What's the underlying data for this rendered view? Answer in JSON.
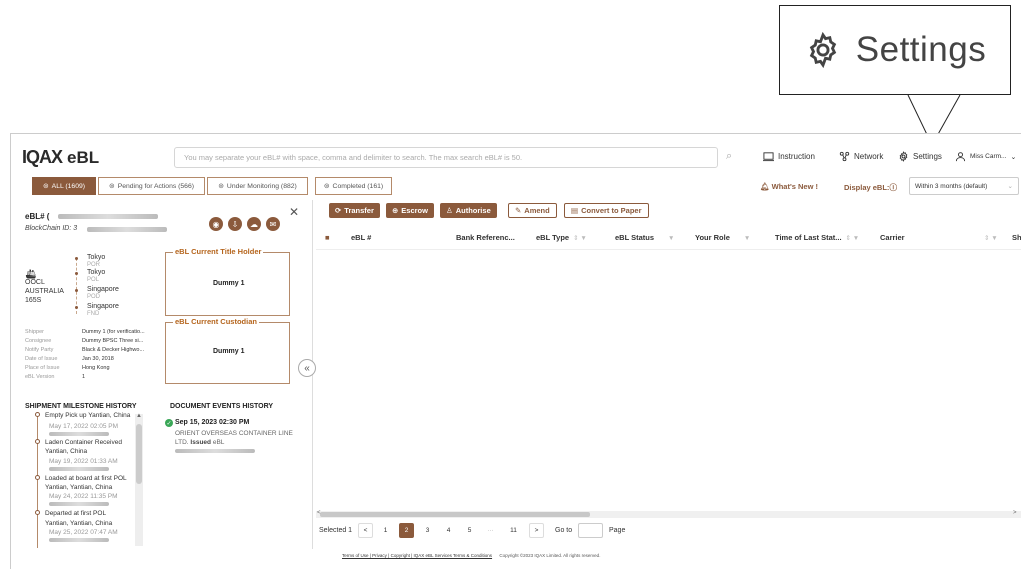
{
  "callout": {
    "label": "Settings"
  },
  "header": {
    "logo_mark": "IQAX",
    "app_name": "eBL",
    "search_placeholder": "You may separate your eBL# with space, comma and delimiter to search. The max search eBL# is 50.",
    "nav": [
      {
        "label": "Instruction",
        "icon": "document-icon"
      },
      {
        "label": "Network",
        "icon": "network-icon"
      },
      {
        "label": "Settings",
        "icon": "gear-icon"
      },
      {
        "label": "Miss Carm...",
        "icon": "user-icon"
      }
    ]
  },
  "tabs": [
    {
      "label": "ALL (1609)",
      "active": true
    },
    {
      "label": "Pending for Actions (566)",
      "active": false
    },
    {
      "label": "Under Monitoring (882)",
      "active": false
    },
    {
      "label": "Completed (161)",
      "active": false
    }
  ],
  "toolbar_right": {
    "whats_new": "What's New !",
    "display_label": "Display eBL:",
    "display_value": "Within 3 months (default)"
  },
  "detail": {
    "ebl_label": "eBL# (",
    "blockchain_label": "BlockChain ID: 3",
    "route": [
      {
        "place": "Tokyo",
        "type": "POR"
      },
      {
        "place": "Tokyo",
        "type": "POL"
      },
      {
        "place": "Singapore",
        "type": "POD"
      },
      {
        "place": "Singapore",
        "type": "FND"
      }
    ],
    "carrier_lines": [
      "OOCL",
      "AUSTRALIA",
      "165S"
    ],
    "title_holder_label": "eBL Current Title Holder",
    "title_holder_value": "Dummy 1",
    "custodian_label": "eBL Current Custodian",
    "custodian_value": "Dummy 1",
    "fields": [
      {
        "k": "Shipper",
        "v": "Dummy 1 (for verificatio..."
      },
      {
        "k": "Consignee",
        "v": "Dummy BPSC Three si..."
      },
      {
        "k": "Notify Party",
        "v": "Black & Decker Highwo..."
      },
      {
        "k": "Date of Issue",
        "v": "Jan 30, 2018"
      },
      {
        "k": "Place of Issue",
        "v": "Hong Kong"
      },
      {
        "k": "eBL Version",
        "v": "1"
      }
    ],
    "milestone_heading": "SHIPMENT MILESTONE HISTORY",
    "milestones": [
      {
        "title": "Empty Pick up Yantian, China",
        "date": "May 17, 2022 02:05 PM"
      },
      {
        "title": "Laden Container Received",
        "title2": "Yantian, China",
        "date": "May 19, 2022 01:33 AM"
      },
      {
        "title": "Loaded at board at first POL",
        "title2": "Yantian, Yantian, China",
        "date": "May 24, 2022 11:35 PM"
      },
      {
        "title": "Departed at first POL",
        "title2": "Yantian, Yantian, China",
        "date": "May 25, 2022 07:47 AM"
      }
    ],
    "events_heading": "DOCUMENT EVENTS HISTORY",
    "event": {
      "date": "Sep 15, 2023 02:30 PM",
      "text": "ORIENT OVERSEAS CONTAINER LINE LTD.",
      "bold": "Issued",
      "suffix": "eBL"
    }
  },
  "actions": [
    {
      "label": "Transfer",
      "style": "filled"
    },
    {
      "label": "Escrow",
      "style": "filled"
    },
    {
      "label": "Authorise",
      "style": "filled"
    },
    {
      "label": "Amend",
      "style": "outline"
    },
    {
      "label": "Convert to Paper",
      "style": "outline"
    }
  ],
  "columns": [
    "eBL #",
    "Bank Referenc...",
    "eBL Type",
    "eBL Status",
    "Your Role",
    "Time of Last Stat...",
    "Carrier",
    "Sh"
  ],
  "pagination": {
    "selected_label": "Selected 1",
    "pages": [
      "1",
      "2",
      "3",
      "4",
      "5",
      "···",
      "11"
    ],
    "active_page": "2",
    "goto": "Go to",
    "page_suffix": "Page"
  },
  "footer": {
    "links": "Terms of Use | Privacy | Copyright | IQAX eBL Services Terms & Conditions",
    "copyright": "Copyright ©2023 IQAX Limited. All rights reserved."
  },
  "colors": {
    "brand": "#8b5a3c",
    "accent_text": "#b5651d",
    "success": "#3aa757"
  }
}
